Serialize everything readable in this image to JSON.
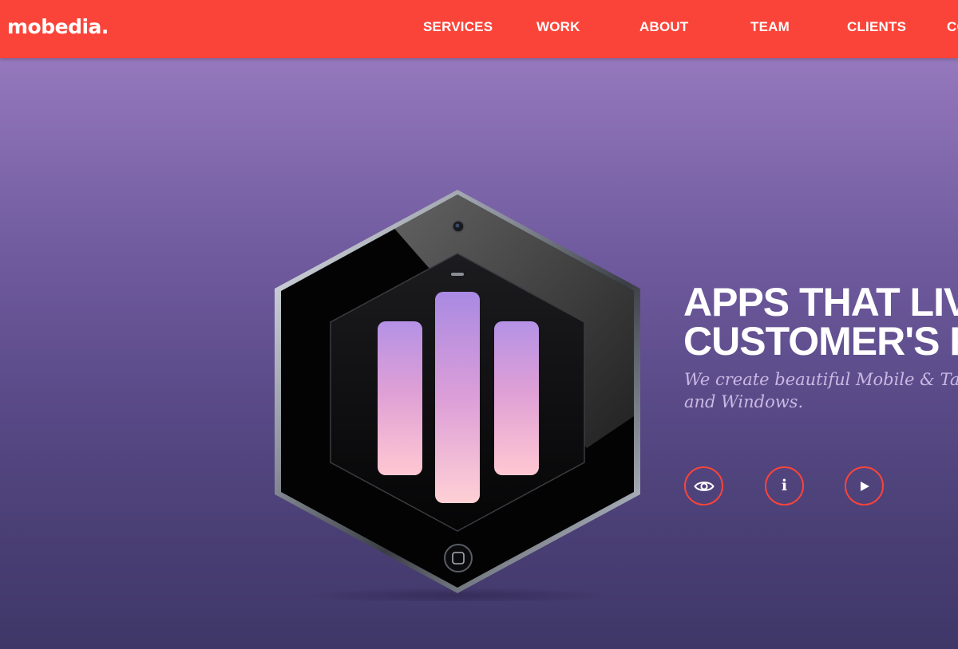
{
  "brand": {
    "logo_text": "mobedia.",
    "accent_color": "#fb4439"
  },
  "nav": {
    "items": [
      {
        "label": "SERVICES"
      },
      {
        "label": "WORK"
      },
      {
        "label": "ABOUT"
      },
      {
        "label": "TEAM"
      },
      {
        "label": "CLIENTS"
      },
      {
        "label": "CO"
      }
    ]
  },
  "hero": {
    "headline_line1": "APPS THAT LIV",
    "headline_line2": "CUSTOMER'S P",
    "subheadline_line1": "We create beautiful Mobile & Tablet",
    "subheadline_line2": "and Windows.",
    "buttons": [
      {
        "icon": "eye-icon"
      },
      {
        "icon": "info-icon",
        "glyph": "i"
      },
      {
        "icon": "play-icon"
      }
    ]
  }
}
